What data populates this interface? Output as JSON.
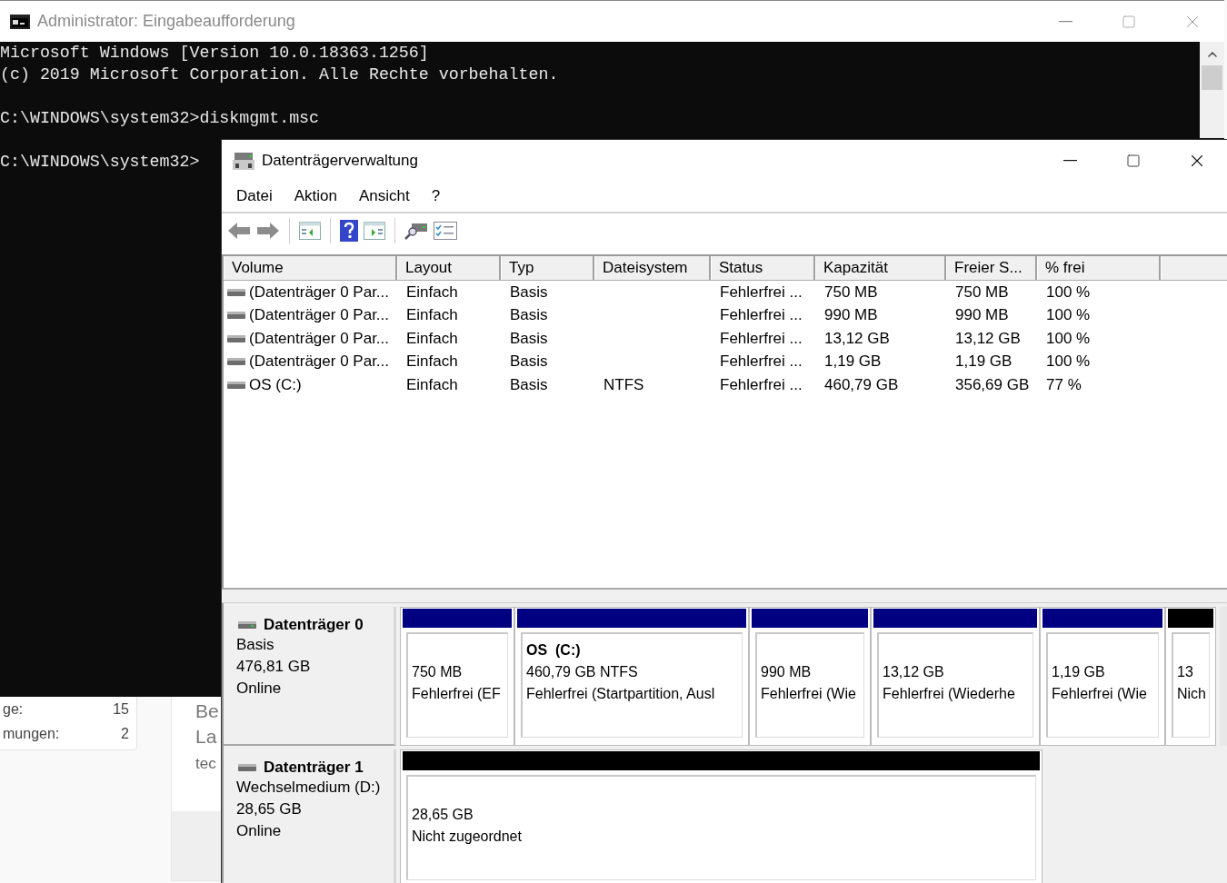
{
  "background_page": {
    "stats": [
      {
        "label": "ge:",
        "value": "15"
      },
      {
        "label": "mungen:",
        "value": "2"
      }
    ],
    "article_lines": [
      "Be",
      "La",
      "tec"
    ]
  },
  "console": {
    "title": "Administrator: Eingabeaufforderung",
    "lines": [
      {
        "text": "Microsoft Windows [Version 10.0.18363.1256]",
        "gap_before": false
      },
      {
        "text": "(c) 2019 Microsoft Corporation. Alle Rechte vorbehalten.",
        "gap_before": false
      },
      {
        "text": "C:\\WINDOWS\\system32>diskmgmt.msc",
        "gap_before": true
      },
      {
        "text": "C:\\WINDOWS\\system32>",
        "gap_before": true
      }
    ]
  },
  "disk_management": {
    "title": "Datenträgerverwaltung",
    "menu": [
      "Datei",
      "Aktion",
      "Ansicht",
      "?"
    ],
    "table": {
      "columns": [
        "Volume",
        "Layout",
        "Typ",
        "Dateisystem",
        "Status",
        "Kapazität",
        "Freier S...",
        "% frei"
      ],
      "rows": [
        [
          "(Datenträger 0 Par...",
          "Einfach",
          "Basis",
          "",
          "Fehlerfrei ...",
          "750 MB",
          "750 MB",
          "100 %"
        ],
        [
          "(Datenträger 0 Par...",
          "Einfach",
          "Basis",
          "",
          "Fehlerfrei ...",
          "990 MB",
          "990 MB",
          "100 %"
        ],
        [
          "(Datenträger 0 Par...",
          "Einfach",
          "Basis",
          "",
          "Fehlerfrei ...",
          "13,12 GB",
          "13,12 GB",
          "100 %"
        ],
        [
          "(Datenträger 0 Par...",
          "Einfach",
          "Basis",
          "",
          "Fehlerfrei ...",
          "1,19 GB",
          "1,19 GB",
          "100 %"
        ],
        [
          "OS (C:)",
          "Einfach",
          "Basis",
          "NTFS",
          "Fehlerfrei ...",
          "460,79 GB",
          "356,69 GB",
          "77 %"
        ]
      ]
    },
    "disks": [
      {
        "name": "Datenträger 0",
        "removable": false,
        "lines": [
          "Basis",
          "476,81 GB",
          "Online"
        ],
        "partitions": [
          {
            "kind": "primary",
            "size": "750 MB",
            "status": "Fehlerfrei (EF"
          },
          {
            "kind": "primary",
            "title": "OS  (C:)",
            "size": "460,79 GB NTFS",
            "status": "Fehlerfrei (Startpartition, Ausl"
          },
          {
            "kind": "primary",
            "size": "990 MB",
            "status": "Fehlerfrei (Wie"
          },
          {
            "kind": "primary",
            "size": "13,12 GB",
            "status": "Fehlerfrei (Wiederhe"
          },
          {
            "kind": "primary",
            "size": "1,19 GB",
            "status": "Fehlerfrei (Wie"
          },
          {
            "kind": "unallocated",
            "size": "13",
            "status": "Nich"
          }
        ]
      },
      {
        "name": "Datenträger 1",
        "removable": true,
        "lines": [
          "Wechselmedium (D:)",
          "28,65 GB",
          "Online"
        ],
        "partitions": [
          {
            "kind": "unallocated",
            "size": "28,65 GB",
            "status": "Nicht zugeordnet"
          }
        ]
      }
    ]
  }
}
